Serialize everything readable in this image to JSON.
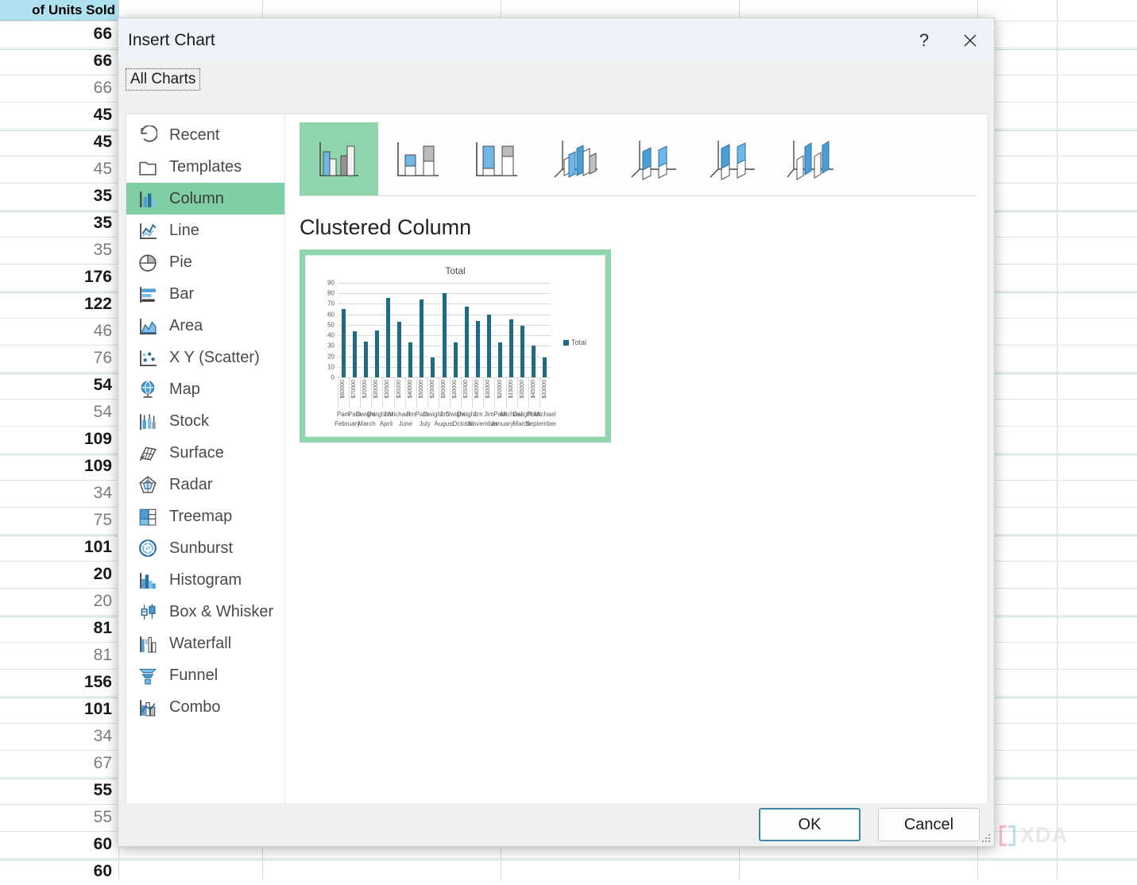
{
  "spreadsheet": {
    "column_header": "of Units Sold",
    "values": [
      {
        "v": "66",
        "bold": true
      },
      {
        "v": "66",
        "bold": true
      },
      {
        "v": "66",
        "bold": false
      },
      {
        "v": "45",
        "bold": true
      },
      {
        "v": "45",
        "bold": true
      },
      {
        "v": "45",
        "bold": false
      },
      {
        "v": "35",
        "bold": true
      },
      {
        "v": "35",
        "bold": true
      },
      {
        "v": "35",
        "bold": false
      },
      {
        "v": "176",
        "bold": true
      },
      {
        "v": "122",
        "bold": true
      },
      {
        "v": "46",
        "bold": false
      },
      {
        "v": "76",
        "bold": false
      },
      {
        "v": "54",
        "bold": true
      },
      {
        "v": "54",
        "bold": false
      },
      {
        "v": "109",
        "bold": true
      },
      {
        "v": "109",
        "bold": true
      },
      {
        "v": "34",
        "bold": false
      },
      {
        "v": "75",
        "bold": false
      },
      {
        "v": "101",
        "bold": true
      },
      {
        "v": "20",
        "bold": true
      },
      {
        "v": "20",
        "bold": false
      },
      {
        "v": "81",
        "bold": true
      },
      {
        "v": "81",
        "bold": false
      },
      {
        "v": "156",
        "bold": true
      },
      {
        "v": "101",
        "bold": true
      },
      {
        "v": "34",
        "bold": false
      },
      {
        "v": "67",
        "bold": false
      },
      {
        "v": "55",
        "bold": true
      },
      {
        "v": "55",
        "bold": false
      },
      {
        "v": "60",
        "bold": true
      },
      {
        "v": "60",
        "bold": true
      }
    ]
  },
  "watermark": {
    "text": "XDA"
  },
  "dialog": {
    "title": "Insert Chart",
    "help_label": "?",
    "close_label": "✕",
    "tab_label": "All Charts",
    "subtitle": "Clustered Column",
    "ok_label": "OK",
    "cancel_label": "Cancel"
  },
  "sidebar": {
    "items": [
      {
        "label": "Recent",
        "icon": "recent-icon",
        "selected": false
      },
      {
        "label": "Templates",
        "icon": "folder-icon",
        "selected": false
      },
      {
        "label": "Column",
        "icon": "column-icon",
        "selected": true
      },
      {
        "label": "Line",
        "icon": "line-icon",
        "selected": false
      },
      {
        "label": "Pie",
        "icon": "pie-icon",
        "selected": false
      },
      {
        "label": "Bar",
        "icon": "bar-icon",
        "selected": false
      },
      {
        "label": "Area",
        "icon": "area-icon",
        "selected": false
      },
      {
        "label": "X Y (Scatter)",
        "icon": "scatter-icon",
        "selected": false
      },
      {
        "label": "Map",
        "icon": "map-globe-icon",
        "selected": false
      },
      {
        "label": "Stock",
        "icon": "stock-icon",
        "selected": false
      },
      {
        "label": "Surface",
        "icon": "surface-icon",
        "selected": false
      },
      {
        "label": "Radar",
        "icon": "radar-icon",
        "selected": false
      },
      {
        "label": "Treemap",
        "icon": "treemap-icon",
        "selected": false
      },
      {
        "label": "Sunburst",
        "icon": "sunburst-icon",
        "selected": false
      },
      {
        "label": "Histogram",
        "icon": "histogram-icon",
        "selected": false
      },
      {
        "label": "Box & Whisker",
        "icon": "boxwhisker-icon",
        "selected": false
      },
      {
        "label": "Waterfall",
        "icon": "waterfall-icon",
        "selected": false
      },
      {
        "label": "Funnel",
        "icon": "funnel-icon",
        "selected": false
      },
      {
        "label": "Combo",
        "icon": "combo-icon",
        "selected": false
      }
    ]
  },
  "thumbnails": [
    {
      "name": "clustered-column",
      "selected": true
    },
    {
      "name": "stacked-column",
      "selected": false
    },
    {
      "name": "100-stacked-column",
      "selected": false
    },
    {
      "name": "3d-clustered-column",
      "selected": false
    },
    {
      "name": "3d-stacked-column",
      "selected": false
    },
    {
      "name": "3d-100-stacked-column",
      "selected": false
    },
    {
      "name": "3d-column",
      "selected": false
    }
  ],
  "colors": {
    "accent_green": "#8fd6ad",
    "selection_green": "#7fcfa4",
    "bar_teal": "#1f6b82",
    "titlebar": "#eef3f9",
    "header_blue": "#aee0ef"
  },
  "chart_data": {
    "type": "bar",
    "title": "Total",
    "xlabel": "",
    "ylabel": "",
    "ylim": [
      0,
      90
    ],
    "yticks": [
      0,
      10,
      20,
      30,
      40,
      50,
      60,
      70,
      80,
      90
    ],
    "grid": true,
    "legend": [
      "Total"
    ],
    "legend_position": "right",
    "categories": [
      "$60000",
      "$70000",
      "$20000",
      "$30000",
      "$30500",
      "$30200",
      "$40000",
      "$50000",
      "$20000",
      "$80000",
      "$30000",
      "$35000",
      "$40000",
      "$30000",
      "$20000",
      "$15000",
      "$35000",
      "$45000",
      "$33000"
    ],
    "names": [
      "Pam",
      "Pam",
      "Dwight",
      "Dwight",
      "Jim",
      "Michael",
      "Jim",
      "Pam",
      "Dwight",
      "Jim",
      "Dwight",
      "Dwight",
      "Jim",
      "Jim",
      "Pam",
      "Michael",
      "Dwight",
      "Pam",
      "Michael"
    ],
    "months": [
      "February",
      "March",
      "April",
      "June",
      "July",
      "August",
      "October",
      "November",
      "January",
      "March",
      "September"
    ],
    "values": [
      65,
      44,
      34,
      45,
      76,
      53,
      33,
      74,
      19,
      80,
      33,
      67,
      54,
      60,
      33,
      55,
      49,
      30,
      19
    ],
    "series": [
      {
        "name": "Total",
        "values": [
          65,
          44,
          34,
          45,
          76,
          53,
          33,
          74,
          19,
          80,
          33,
          67,
          54,
          60,
          33,
          55,
          49,
          30,
          19
        ]
      }
    ]
  }
}
